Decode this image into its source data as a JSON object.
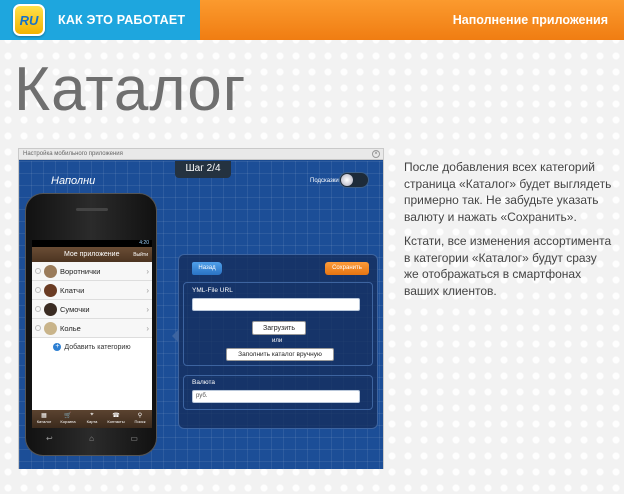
{
  "header": {
    "logo_text": "RU",
    "nav_title": "КАК ЭТО РАБОТАЕТ",
    "section": "Наполнение приложения",
    "left_color": "#1ea6de",
    "right_color": "#f28116"
  },
  "page": {
    "title": "Каталог"
  },
  "window": {
    "title": "Настройка мобильного приложения",
    "close_glyph": "×",
    "step": "Шаг 2/4",
    "canvas_title": "Наполни",
    "hint_label": "Подсказки"
  },
  "phone": {
    "status": "4:20",
    "app_title": "Мое приложение",
    "exit": "Выйти",
    "categories": [
      {
        "label": "Воротнички",
        "thumb_color": "#9a7b5a"
      },
      {
        "label": "Клатчи",
        "thumb_color": "#6a3b23"
      },
      {
        "label": "Сумочки",
        "thumb_color": "#3a2b22"
      },
      {
        "label": "Колье",
        "thumb_color": "#c9b48a"
      }
    ],
    "arrow_glyph": "›",
    "add_label": "Добавить категорию",
    "tabs": [
      {
        "icon": "▦",
        "label": "Каталог"
      },
      {
        "icon": "🛒",
        "label": "Корзина"
      },
      {
        "icon": "⌖",
        "label": "Карта"
      },
      {
        "icon": "☎",
        "label": "Контакты"
      },
      {
        "icon": "⚲",
        "label": "Поиск"
      }
    ],
    "buttons": [
      "↩",
      "⌂",
      "▭"
    ]
  },
  "form": {
    "back": "Назад",
    "save": "Сохранить",
    "yml_label": "YML-File URL",
    "yml_value": "",
    "upload": "Загрузить",
    "or": "или",
    "manual": "Заполнить каталог вручную",
    "currency_label": "Валюта",
    "currency_value": "руб."
  },
  "description": {
    "p1": "После добавления всех категорий страница «Каталог» будет выглядеть примерно так. Не забудьте указать валюту и нажать «Сохранить».",
    "p2": "Кстати, все изменения ассортимента в категории «Каталог» будут сразу же отображаться в смартфонах ваших клиентов."
  }
}
